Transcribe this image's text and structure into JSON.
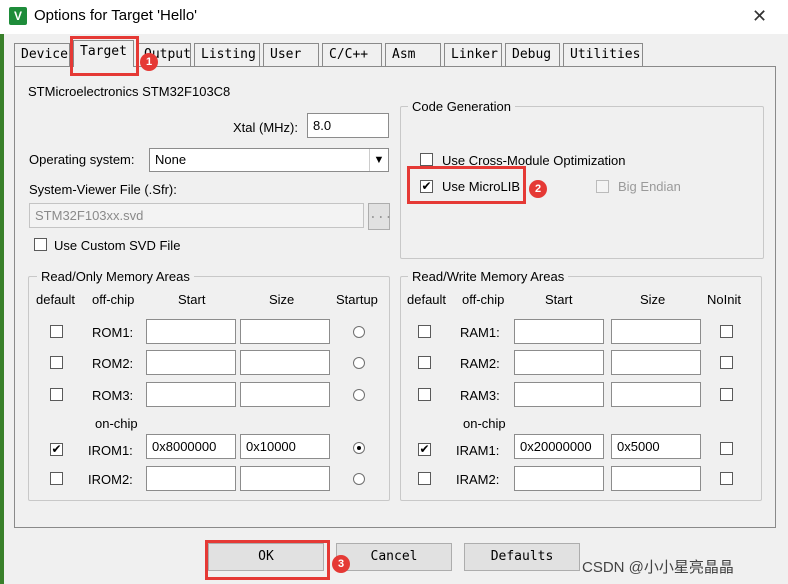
{
  "window": {
    "title": "Options for Target 'Hello'",
    "close_glyph": "✕",
    "icon_letter": "V"
  },
  "tabs": [
    "Device",
    "Target",
    "Output",
    "Listing",
    "User",
    "C/C++",
    "Asm",
    "Linker",
    "Debug",
    "Utilities"
  ],
  "active_tab": "Target",
  "device_name": "STMicroelectronics STM32F103C8",
  "xtal": {
    "label": "Xtal (MHz):",
    "value": "8.0"
  },
  "os": {
    "label": "Operating system:",
    "value": "None"
  },
  "sfr": {
    "label": "System-Viewer File (.Sfr):",
    "value": "STM32F103xx.svd",
    "browse_label": "..."
  },
  "custom_svd": {
    "label": "Use Custom SVD File",
    "checked": false
  },
  "code_gen": {
    "title": "Code Generation",
    "cross_module": {
      "label": "Use Cross-Module Optimization",
      "checked": false
    },
    "microlib": {
      "label": "Use MicroLIB",
      "checked": true
    },
    "big_endian": {
      "label": "Big Endian",
      "checked": false
    }
  },
  "rom": {
    "title": "Read/Only Memory Areas",
    "headers": {
      "default": "default",
      "offchip": "off-chip",
      "start": "Start",
      "size": "Size",
      "startup": "Startup"
    },
    "onchip_label": "on-chip",
    "rows": [
      {
        "label": "ROM1:",
        "start": "",
        "size": "",
        "default": false,
        "startup": false
      },
      {
        "label": "ROM2:",
        "start": "",
        "size": "",
        "default": false,
        "startup": false
      },
      {
        "label": "ROM3:",
        "start": "",
        "size": "",
        "default": false,
        "startup": false
      },
      {
        "label": "IROM1:",
        "start": "0x8000000",
        "size": "0x10000",
        "default": true,
        "startup": true
      },
      {
        "label": "IROM2:",
        "start": "",
        "size": "",
        "default": false,
        "startup": false
      }
    ]
  },
  "ram": {
    "title": "Read/Write Memory Areas",
    "headers": {
      "default": "default",
      "offchip": "off-chip",
      "start": "Start",
      "size": "Size",
      "noinit": "NoInit"
    },
    "onchip_label": "on-chip",
    "rows": [
      {
        "label": "RAM1:",
        "start": "",
        "size": "",
        "default": false,
        "noinit": false
      },
      {
        "label": "RAM2:",
        "start": "",
        "size": "",
        "default": false,
        "noinit": false
      },
      {
        "label": "RAM3:",
        "start": "",
        "size": "",
        "default": false,
        "noinit": false
      },
      {
        "label": "IRAM1:",
        "start": "0x20000000",
        "size": "0x5000",
        "default": true,
        "noinit": false
      },
      {
        "label": "IRAM2:",
        "start": "",
        "size": "",
        "default": false,
        "noinit": false
      }
    ]
  },
  "buttons": {
    "ok": "OK",
    "cancel": "Cancel",
    "defaults": "Defaults"
  },
  "annotations": {
    "badge1": "1",
    "badge2": "2",
    "badge3": "3",
    "color": "#e53935"
  },
  "watermark": "CSDN @小小星亮晶晶"
}
